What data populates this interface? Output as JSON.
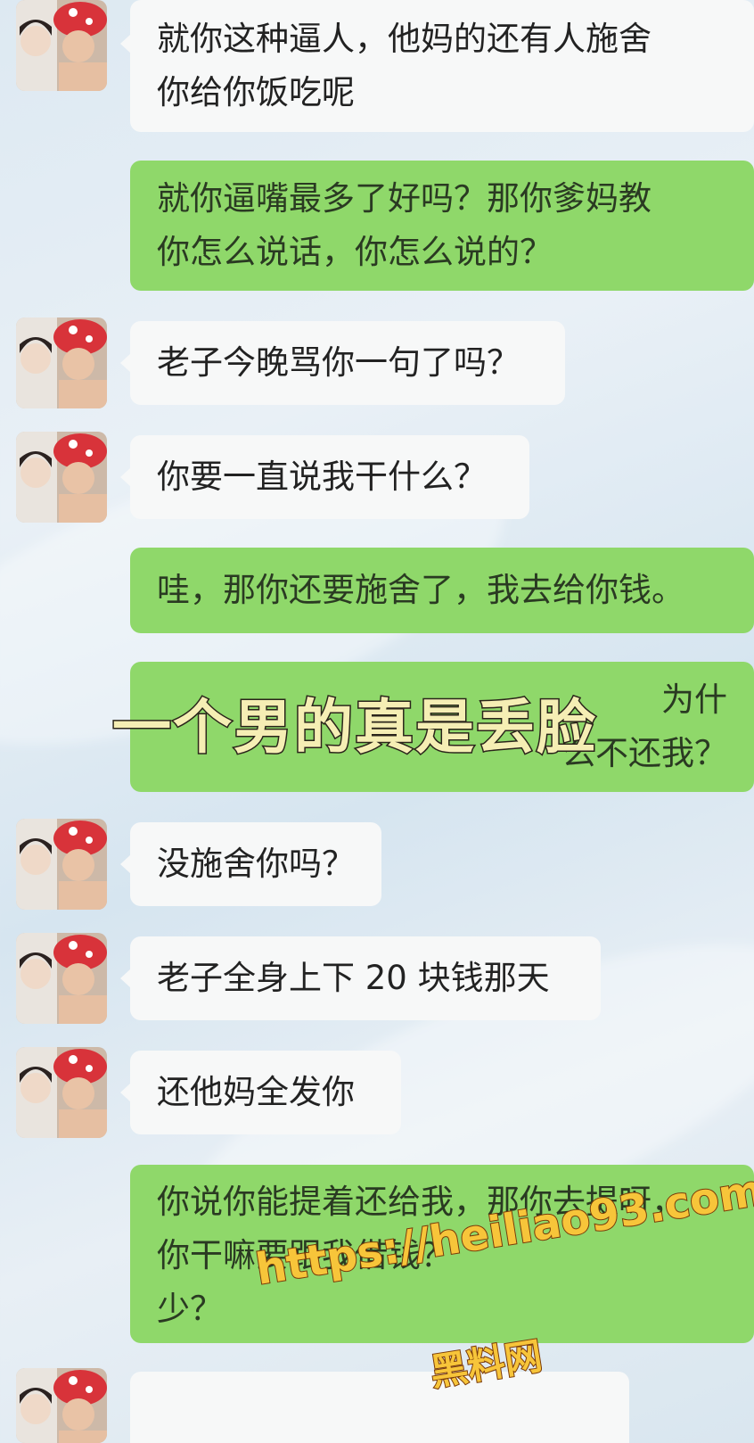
{
  "chat": {
    "messages": [
      {
        "side": "left",
        "text": "就你这种逼人，他妈的还有人施舍\n你给你饭吃呢"
      },
      {
        "side": "right",
        "text": "就你逼嘴最多了好吗？那你爹妈教\n你怎么说话，你怎么说的？"
      },
      {
        "side": "left",
        "text": "老子今晚骂你一句了吗？"
      },
      {
        "side": "left",
        "text": "你要一直说我干什么？"
      },
      {
        "side": "right",
        "text": "哇，那你还要施舍了，我去给你钱。"
      },
      {
        "side": "right",
        "text": "为什\n么不还我？"
      },
      {
        "side": "left",
        "text": "没施舍你吗？"
      },
      {
        "side": "left",
        "text": "老子全身上下 20 块钱那天"
      },
      {
        "side": "left",
        "text": "还他妈全发你"
      },
      {
        "side": "right",
        "text": "你说你能提着还给我，那你去提呀，\n你干嘛要跟我借钱？\n少？"
      }
    ]
  },
  "overlay": {
    "caption": "一个男的真是丢脸"
  },
  "watermark": {
    "url": "https://heiliao93.com",
    "site_name": "黑料网"
  },
  "colors": {
    "own_bubble": "#8fd86a",
    "peer_bubble": "#f7f8f8",
    "caption_fill": "#f5eeb4",
    "watermark_fill": "#f7c53a"
  }
}
